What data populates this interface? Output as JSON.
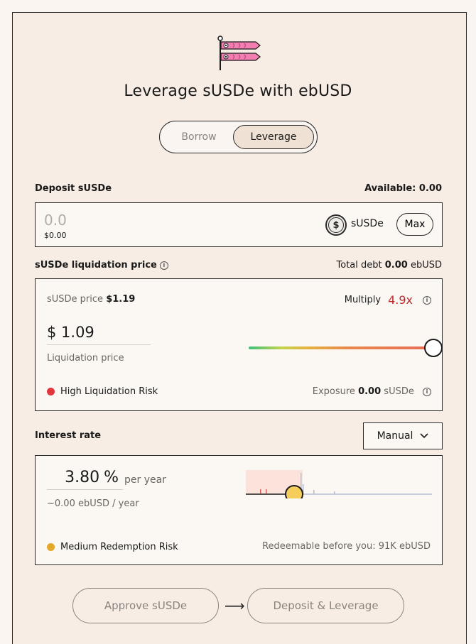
{
  "header": {
    "title": "Leverage sUSDe with ebUSD",
    "logo_icon": "koinobori-icon"
  },
  "tabs": [
    {
      "label": "Borrow",
      "active": false
    },
    {
      "label": "Leverage",
      "active": true
    }
  ],
  "deposit": {
    "label": "Deposit sUSDe",
    "available": "Available: 0.00",
    "placeholder": "0.0",
    "usd_value": "$0.00",
    "token": "sUSDe",
    "token_icon": "dollar-coin-icon",
    "max_label": "Max"
  },
  "liquidation": {
    "label": "sUSDe liquidation price",
    "total_debt_prefix": "Total debt",
    "total_debt_value": "0.00",
    "total_debt_unit": "ebUSD",
    "price_prefix": "sUSDe price",
    "price_value": "$1.19",
    "multiply_label": "Multiply",
    "multiply_value": "4.9x",
    "liq_price": "$ 1.09",
    "liq_price_label": "Liquidation price",
    "leverage_slider_level": 1.0,
    "risk_label": "High Liquidation Risk",
    "risk_color": "#e0353b",
    "exposure_prefix": "Exposure",
    "exposure_value": "0.00",
    "exposure_unit": "sUSDe"
  },
  "interest": {
    "label": "Interest rate",
    "mode": "Manual",
    "rate_value": "3.80",
    "rate_unit": "%",
    "per_year": "per year",
    "sub": "~0.00 ebUSD / year",
    "risk_label": "Medium Redemption Risk",
    "risk_color": "#e3a82a",
    "redeemable": "Redeemable before you: 91K ebUSD"
  },
  "actions": {
    "approve": "Approve sUSDe",
    "deposit": "Deposit & Leverage"
  },
  "colors": {
    "accent_red": "#c0252a",
    "thumb_yellow": "#f5cd5a",
    "background": "#f7ede4"
  }
}
